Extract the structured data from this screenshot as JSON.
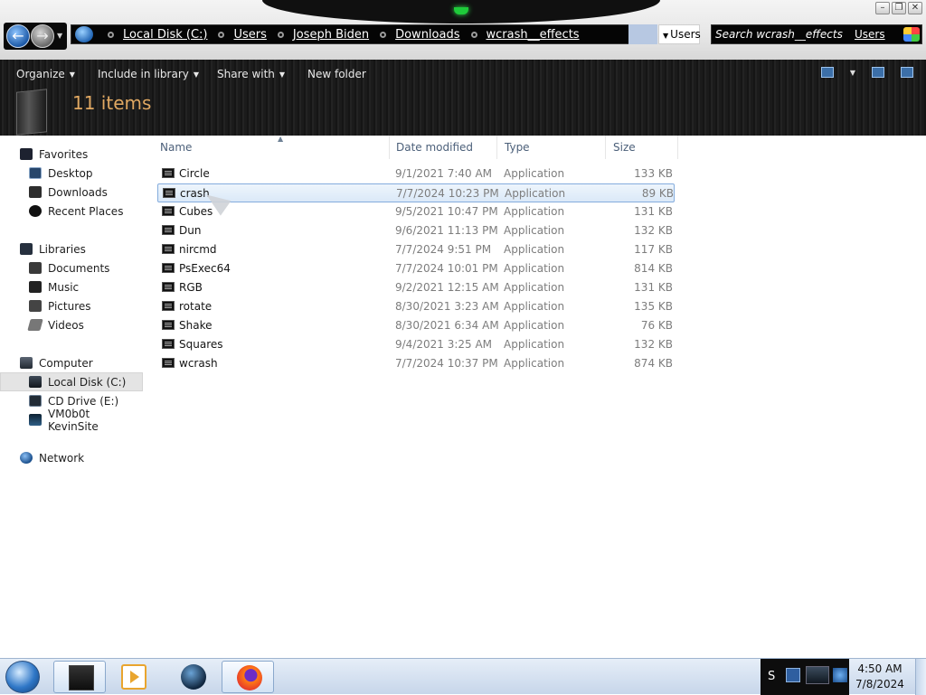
{
  "address": {
    "crumbs": [
      "Local Disk (C:)",
      "Users",
      "Joseph Biden",
      "Downloads",
      "wcrash__effects"
    ],
    "dropdown_label": "Users"
  },
  "search": {
    "placeholder": "Search wcrash__effects",
    "overlay_text": "Users"
  },
  "commandbar": {
    "organize": "Organize",
    "include": "Include in library",
    "share": "Share with",
    "new_folder": "New folder"
  },
  "header": {
    "item_count": "11 items"
  },
  "nav": {
    "favorites": "Favorites",
    "desktop": "Desktop",
    "downloads": "Downloads",
    "recent": "Recent Places",
    "libraries": "Libraries",
    "documents": "Documents",
    "music": "Music",
    "pictures": "Pictures",
    "videos": "Videos",
    "computer": "Computer",
    "local_disk": "Local Disk (C:)",
    "cd_drive": "CD Drive (E:)",
    "netdrive": "VM0b0t KevinSite",
    "network": "Network"
  },
  "columns": {
    "name": "Name",
    "date": "Date modified",
    "type": "Type",
    "size": "Size"
  },
  "files": [
    {
      "name": "Circle",
      "date": "9/1/2021 7:40 AM",
      "type": "Application",
      "size": "133 KB"
    },
    {
      "name": "crash",
      "date": "7/7/2024 10:23 PM",
      "type": "Application",
      "size": "89 KB"
    },
    {
      "name": "Cubes",
      "date": "9/5/2021 10:47 PM",
      "type": "Application",
      "size": "131 KB"
    },
    {
      "name": "Dun",
      "date": "9/6/2021 11:13 PM",
      "type": "Application",
      "size": "132 KB"
    },
    {
      "name": "nircmd",
      "date": "7/7/2024 9:51 PM",
      "type": "Application",
      "size": "117 KB"
    },
    {
      "name": "PsExec64",
      "date": "7/7/2024 10:01 PM",
      "type": "Application",
      "size": "814 KB"
    },
    {
      "name": "RGB",
      "date": "9/2/2021 12:15 AM",
      "type": "Application",
      "size": "131 KB"
    },
    {
      "name": "rotate",
      "date": "8/30/2021 3:23 AM",
      "type": "Application",
      "size": "135 KB"
    },
    {
      "name": "Shake",
      "date": "8/30/2021 6:34 AM",
      "type": "Application",
      "size": "76 KB"
    },
    {
      "name": "Squares",
      "date": "9/4/2021 3:25 AM",
      "type": "Application",
      "size": "132 KB"
    },
    {
      "name": "wcrash",
      "date": "7/7/2024 10:37 PM",
      "type": "Application",
      "size": "874 KB"
    }
  ],
  "selected_file": "crash",
  "tray": {
    "s_label": "S",
    "time": "4:50 AM",
    "date": "7/8/2024"
  },
  "colors": {
    "item_count": "#e0a862",
    "selection_border": "#84acdd",
    "column_header": "#4c607a"
  }
}
